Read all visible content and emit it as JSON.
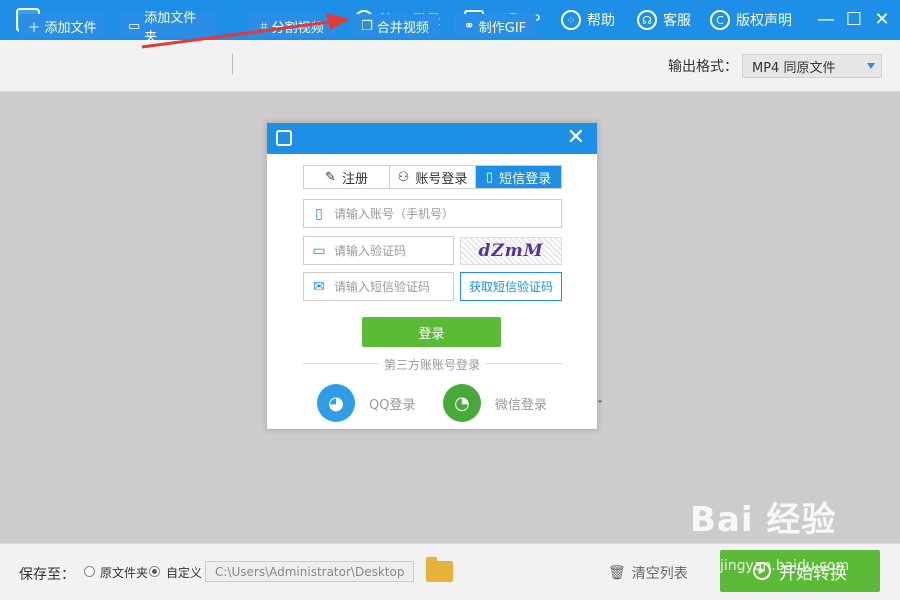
{
  "titlebar": {
    "register_login": "注册/登录",
    "vip": "开通VIP",
    "help": "帮助",
    "service": "客服",
    "copyright": "版权声明",
    "minimize": "—",
    "maximize": "☐",
    "close": "✕"
  },
  "toolbar": {
    "add_file": "添加文件",
    "add_folder": "添加文件夹",
    "split_video": "分割视频",
    "merge_video": "合并视频",
    "make_gif": "制作GIF",
    "format_label": "输出格式：",
    "format_value": "MP4  同原文件"
  },
  "login_dialog": {
    "close": "✕",
    "tabs": [
      {
        "label": "注册",
        "icon": "pencil-icon"
      },
      {
        "label": "账号登录",
        "icon": "user-icon"
      },
      {
        "label": "短信登录",
        "icon": "phone-icon",
        "active": true
      }
    ],
    "phone_placeholder": "请输入账号（手机号）",
    "captcha_placeholder": "请输入验证码",
    "captcha_text": "dZmM",
    "sms_placeholder": "请输入短信验证码",
    "get_sms_code": "获取短信验证码",
    "login": "登录",
    "third_party": "第三方账账号登录",
    "qq_login": "QQ登录",
    "wechat_login": "微信登录"
  },
  "bottombar": {
    "save_to": "保存至：",
    "option_original": "原文件夹",
    "option_custom": "自定义",
    "path": "C:\\Users\\Administrator\\Desktop",
    "clear_list": "清空列表",
    "start_convert": "开始转换"
  },
  "watermark": {
    "main": "Bai 经验",
    "sub": "jingyan.baidu.com"
  },
  "colors": {
    "brand_blue": "#1e8fe6",
    "green": "#5cbb36",
    "annotation_red": "#e53935"
  }
}
